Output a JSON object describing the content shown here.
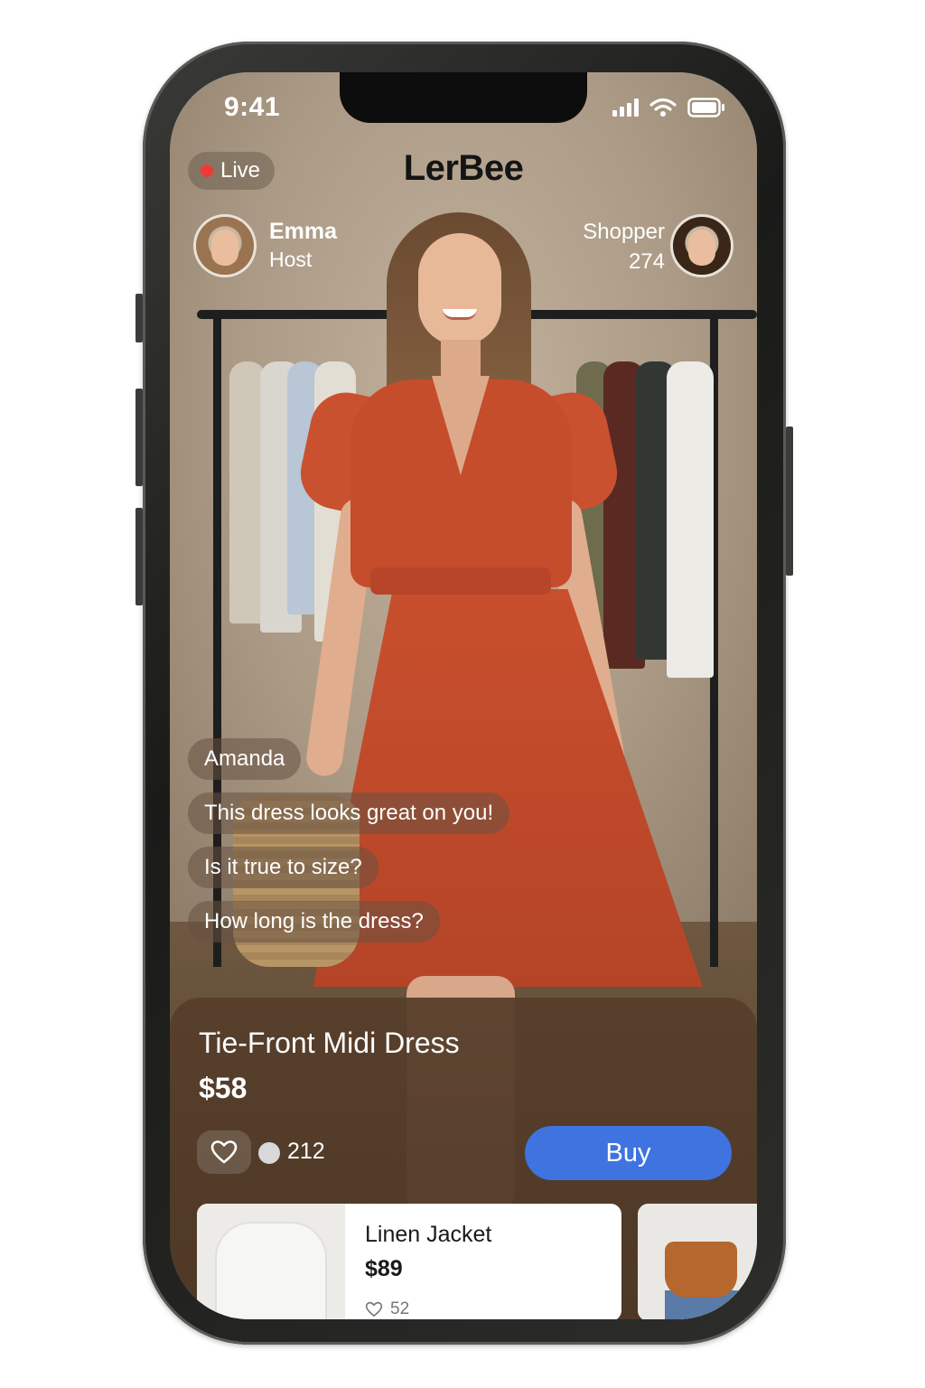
{
  "status_bar": {
    "time": "9:41"
  },
  "app": {
    "brand": "LerBee",
    "live_label": "Live"
  },
  "host": {
    "name": "Emma",
    "role": "Host"
  },
  "shopper": {
    "label": "Shopper",
    "count": "274"
  },
  "chat": [
    "Amanda",
    "This dress looks great on you!",
    "Is it true to size?",
    "How long is the dress?"
  ],
  "product": {
    "title": "Tie-Front Midi Dress",
    "price": "$58",
    "comment_count": "212",
    "buy_label": "Buy"
  },
  "cards": [
    {
      "name": "Linen Jacket",
      "price": "$89",
      "likes": "52"
    }
  ],
  "colors": {
    "live_dot": "#ec3b36",
    "buy_button": "#3f73e0",
    "dress": "#c54d2c",
    "panel": "#563e2a"
  },
  "icons": [
    "signal-icon",
    "wifi-icon",
    "battery-icon",
    "heart-icon",
    "comment-icon"
  ]
}
